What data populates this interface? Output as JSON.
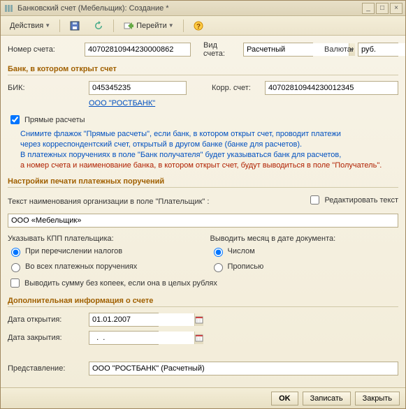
{
  "window": {
    "title": "Банковский счет (Мебельщик): Создание *"
  },
  "toolbar": {
    "actions_label": "Действия",
    "goto_label": "Перейти"
  },
  "fields": {
    "account_number_label": "Номер счета:",
    "account_number_value": "40702810944230000862",
    "account_type_label": "Вид счета:",
    "account_type_value": "Расчетный",
    "currency_label": "Валюта:",
    "currency_value": "руб."
  },
  "bank_section": {
    "title": "Банк, в котором открыт счет",
    "bik_label": "БИК:",
    "bik_value": "045345235",
    "corr_label": "Корр. счет:",
    "corr_value": "40702810944230012345",
    "bank_link": "ООО \"РОСТБАНК\""
  },
  "direct_settlements": {
    "checkbox_label": "Прямые расчеты",
    "note_line1": "Снимите флажок \"Прямые расчеты\", если банк, в котором открыт счет, проводит платежи",
    "note_line2": "через корреспондентский счет, открытый в другом банке (банке для расчетов).",
    "note_line3": "В платежных поручениях в поле \"Банк получателя\" будет указываться банк для расчетов,",
    "note_line4": "а номер счета и наименование банка, в котором открыт счет, будут выводиться в поле \"Получатель\"."
  },
  "print_section": {
    "title": "Настройки печати платежных поручений",
    "payer_name_label": "Текст наименования организации в поле \"Плательщик\" :",
    "edit_text_label": "Редактировать текст",
    "payer_name_value": "ООО «Мебельщик»",
    "kpp_label": "Указывать КПП плательщика:",
    "kpp_option1": "При перечислении налогов",
    "kpp_option2": "Во всех платежных поручениях",
    "month_label": "Выводить месяц в дате документа:",
    "month_option1": "Числом",
    "month_option2": "Прописью",
    "no_kopecks_label": "Выводить сумму без копеек, если она в целых рублях"
  },
  "extra_section": {
    "title": "Дополнительная информация о счете",
    "open_date_label": "Дата открытия:",
    "open_date_value": "01.01.2007",
    "close_date_label": "Дата закрытия:",
    "close_date_value": "  .  .    "
  },
  "representation": {
    "label": "Представление:",
    "value": "ООО \"РОСТБАНК\" (Расчетный)"
  },
  "footer": {
    "ok": "OK",
    "save": "Записать",
    "close": "Закрыть"
  }
}
